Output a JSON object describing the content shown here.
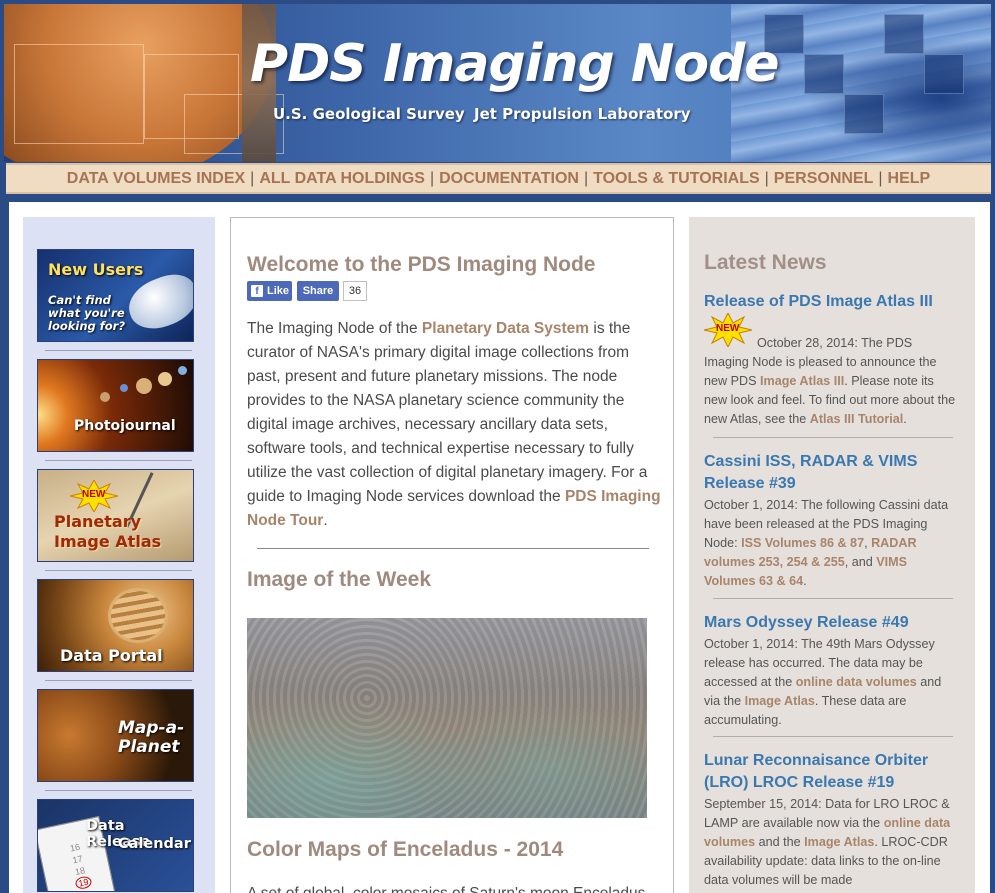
{
  "banner": {
    "title": "PDS Imaging Node",
    "subtitle_left": "U.S. Geological Survey",
    "subtitle_right": "Jet Propulsion Laboratory"
  },
  "nav": {
    "items": [
      "DATA VOLUMES INDEX",
      "ALL DATA HOLDINGS",
      "DOCUMENTATION",
      "TOOLS & TUTORIALS",
      "PERSONNEL",
      "HELP"
    ],
    "separator": "|"
  },
  "sidebar": {
    "new_users": {
      "title": "New Users",
      "line1": "Can't find",
      "line2": "what you're",
      "line3": "looking for?"
    },
    "photojournal": {
      "label": "Photojournal"
    },
    "atlas": {
      "badge": "NEW",
      "line1": "Planetary",
      "line2": "Image Atlas"
    },
    "data_portal": {
      "label": "Data Portal"
    },
    "map_a_planet": {
      "line1": "Map-a-",
      "line2": "Planet"
    },
    "release_calendar": {
      "line1": "Data Release",
      "line2": "Calendar",
      "nums": [
        "16",
        "17",
        "18",
        "19"
      ]
    }
  },
  "main": {
    "welcome_title": "Welcome to the PDS Imaging Node",
    "fb": {
      "like": "Like",
      "share": "Share",
      "count": "36"
    },
    "intro": {
      "t1": "The Imaging Node of the ",
      "l1": "Planetary Data System",
      "t2": " is the curator of NASA's primary digital image collections from past, present and future planetary missions. The node provides to the NASA planetary science community the digital image archives, necessary ancillary data sets, software tools, and technical expertise necessary to fully utilize the vast collection of digital planetary imagery. For a guide to Imaging Node services download the ",
      "l2": "PDS Imaging Node Tour",
      "t3": "."
    },
    "iotw_title": "Image of the Week",
    "caption_title": "Color Maps of Enceladus - 2014",
    "caption_text": "A set of global, color mosaics of Saturn's moon Enceladus"
  },
  "news": {
    "heading": "Latest News",
    "items": [
      {
        "title": "Release of PDS Image Atlas III",
        "badge": "NEW",
        "t1": "October 28, 2014: The PDS Imaging Node is pleased to announce the new PDS ",
        "l1": "Image Atlas III",
        "t2": ". Please note its new look and feel. To find out more about the new Atlas, see the ",
        "l2": "Atlas III Tutorial",
        "t3": "."
      },
      {
        "title": "Cassini ISS, RADAR & VIMS Release #39",
        "t1": "October 1, 2014: The following Cassini data have been released at the PDS Imaging Node: ",
        "l1": "ISS Volumes 86 & 87",
        "t2": ", ",
        "l2": "RADAR volumes 253, 254 & 255",
        "t3": ", and ",
        "l3": "VIMS Volumes 63 & 64",
        "t4": "."
      },
      {
        "title": "Mars Odyssey Release #49",
        "t1": "October 1, 2014: The 49th Mars Odyssey release has occurred. The data may be accessed at the ",
        "l1": "online data volumes",
        "t2": " and via the ",
        "l2": "Image Atlas",
        "t3": ". These data are accumulating."
      },
      {
        "title": "Lunar Reconnaisance Orbiter (LRO) LROC Release #19",
        "t1": "September 15, 2014: Data for LRO LROC & LAMP are available now via the ",
        "l1": "online data volumes",
        "t2": " and the ",
        "l2": "Image Atlas",
        "t3": ". LROC-CDR availability update: data links to the on-line data volumes will be made"
      }
    ]
  },
  "colors": {
    "banner_blue": "#2a4b86",
    "nav_bg": "#f0dcc2",
    "nav_text": "#a57454",
    "link_tan": "#a8846a",
    "news_title_blue": "#3a78b0",
    "heading_taupe": "#a08a7e"
  }
}
